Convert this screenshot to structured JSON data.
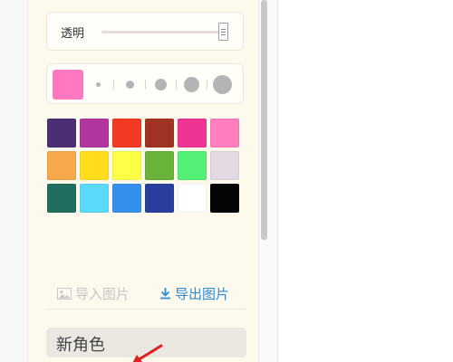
{
  "opacity": {
    "label": "透明",
    "value": 1.0
  },
  "brush": {
    "current_color": "#ff78c0",
    "sizes": [
      "size-1",
      "size-2",
      "size-3",
      "size-4",
      "size-5"
    ]
  },
  "palette": [
    [
      "#4b2f74",
      "#b0359c",
      "#f03a24",
      "#a13324",
      "#f03494",
      "#ff7ec0"
    ],
    [
      "#f7a84a",
      "#ffdd1e",
      "#fdff46",
      "#6ab33a",
      "#55f176",
      "#e3d9e3"
    ],
    [
      "#1f6e5f",
      "#5ad9fc",
      "#3390ec",
      "#2a3f9d",
      "#ffffff",
      "#050505"
    ]
  ],
  "actions": {
    "import_label": "导入图片",
    "export_label": "导出图片",
    "import_icon": "image-icon",
    "export_icon": "download-icon"
  },
  "role": {
    "label": "新角色"
  }
}
